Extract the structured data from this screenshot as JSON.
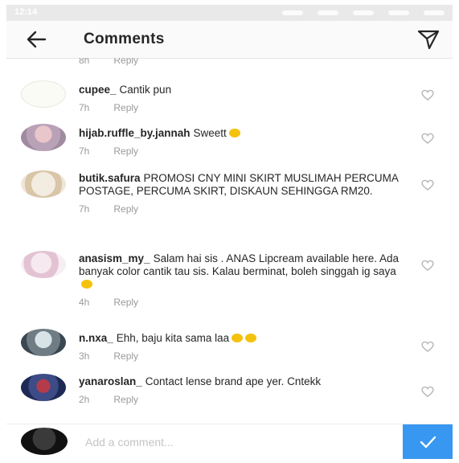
{
  "status_bar": {
    "time": "12:14"
  },
  "header": {
    "title": "Comments"
  },
  "previous": {
    "time": "8h",
    "reply": "Reply"
  },
  "comments": [
    {
      "username": "cupee_",
      "text": "Cantik pun",
      "time": "7h",
      "reply": "Reply"
    },
    {
      "username": "hijab.ruffle_by.jannah",
      "text": "Sweett",
      "time": "7h",
      "reply": "Reply"
    },
    {
      "username": "butik.safura",
      "text": "PROMOSI CNY MINI SKIRT MUSLIMAH PERCUMA POSTAGE, PERCUMA SKIRT, DISKAUN SEHINGGA RM20.",
      "time": "7h",
      "reply": "Reply"
    },
    {
      "username": "anasism_my_",
      "text": "Salam hai sis . ANAS Lipcream available here. Ada banyak color cantik tau sis. Kalau berminat, boleh singgah ig saya",
      "time": "4h",
      "reply": "Reply"
    },
    {
      "username": "n.nxa_",
      "text": "Ehh, baju kita sama laa",
      "time": "3h",
      "reply": "Reply"
    },
    {
      "username": "yanaroslan_",
      "text": "Contact lense brand ape yer. Cntekk",
      "time": "2h",
      "reply": "Reply"
    }
  ],
  "footer": {
    "placeholder": "Add a comment..."
  },
  "colors": {
    "accent": "#3897f0",
    "meta": "#9a9a9a",
    "emoji": "#f4c20d"
  }
}
